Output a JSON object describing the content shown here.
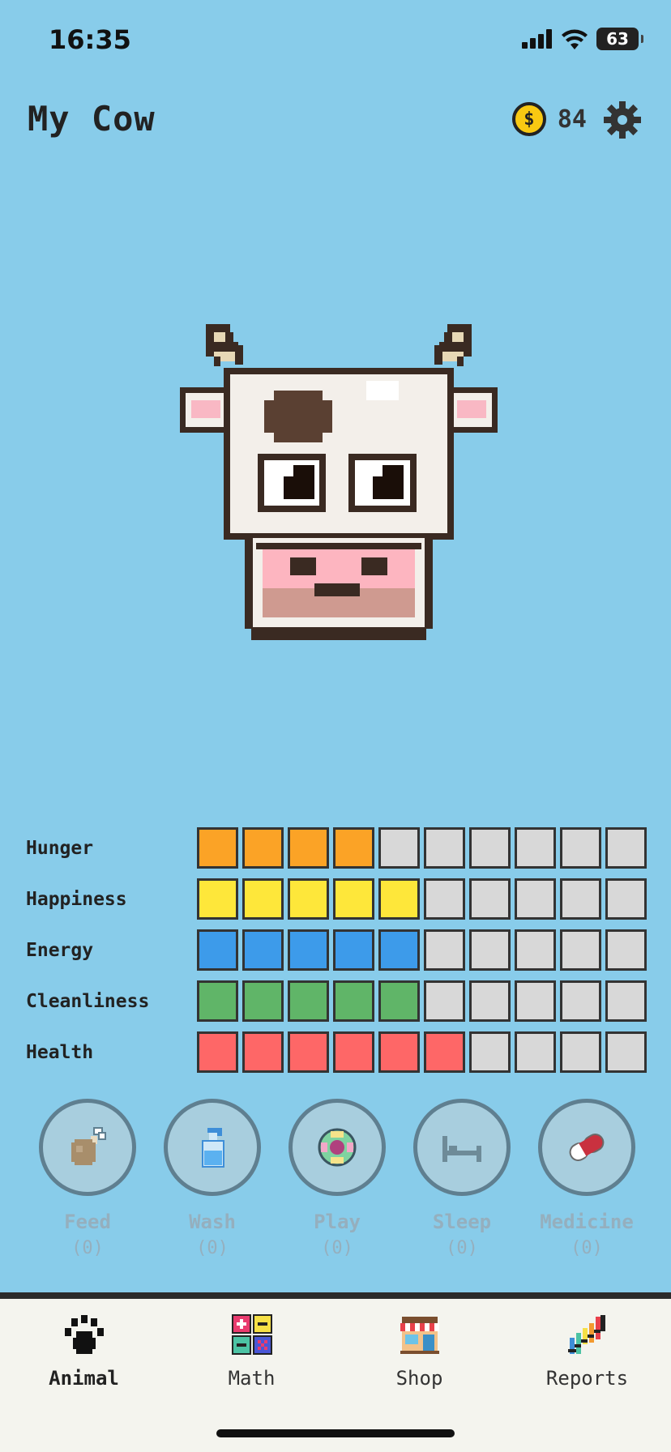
{
  "status_bar": {
    "time": "16:35",
    "battery": "63"
  },
  "header": {
    "title": "My Cow",
    "coin_symbol": "$",
    "coins": "84"
  },
  "stats": [
    {
      "label": "Hunger",
      "value": 4,
      "max": 10,
      "color": "#FBA326"
    },
    {
      "label": "Happiness",
      "value": 5,
      "max": 10,
      "color": "#FEE73A"
    },
    {
      "label": "Energy",
      "value": 5,
      "max": 10,
      "color": "#3D9BEA"
    },
    {
      "label": "Cleanliness",
      "value": 5,
      "max": 10,
      "color": "#60B568"
    },
    {
      "label": "Health",
      "value": 6,
      "max": 10,
      "color": "#FE6767"
    }
  ],
  "actions": [
    {
      "label": "Feed",
      "count": "(0)",
      "icon": "drumstick-icon"
    },
    {
      "label": "Wash",
      "count": "(0)",
      "icon": "soap-bottle-icon"
    },
    {
      "label": "Play",
      "count": "(0)",
      "icon": "ball-icon"
    },
    {
      "label": "Sleep",
      "count": "(0)",
      "icon": "bed-icon"
    },
    {
      "label": "Medicine",
      "count": "(0)",
      "icon": "pill-icon"
    }
  ],
  "tabs": [
    {
      "label": "Animal",
      "icon": "paw-icon",
      "active": true
    },
    {
      "label": "Math",
      "icon": "math-icon",
      "active": false
    },
    {
      "label": "Shop",
      "icon": "shop-icon",
      "active": false
    },
    {
      "label": "Reports",
      "icon": "chart-icon",
      "active": false
    }
  ],
  "colors": {
    "background": "#88CCEA",
    "empty_segment": "#D8D8D8",
    "tab_bar": "#F4F4EE"
  }
}
